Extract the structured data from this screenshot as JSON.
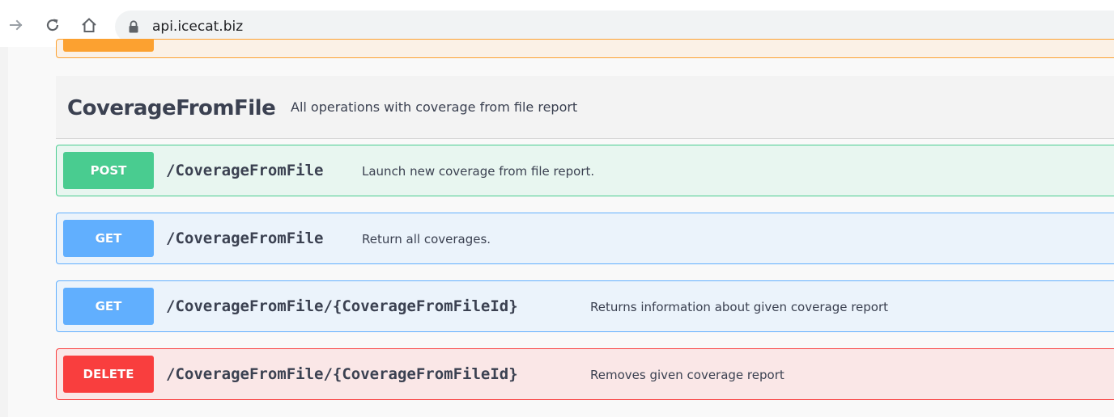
{
  "browser": {
    "url": "api.icecat.biz",
    "forward_icon": "arrow-right-icon",
    "reload_icon": "reload-icon",
    "home_icon": "home-icon",
    "lock_icon": "lock-icon"
  },
  "tag": {
    "title": "CoverageFromFile",
    "description": "All operations with coverage from file report"
  },
  "operations": [
    {
      "method": "POST",
      "path": "/CoverageFromFile",
      "summary": "Launch new coverage from file report.",
      "color": "#49cc90"
    },
    {
      "method": "GET",
      "path": "/CoverageFromFile",
      "summary": "Return all coverages.",
      "color": "#61affe"
    },
    {
      "method": "GET",
      "path": "/CoverageFromFile/{CoverageFromFileId}",
      "summary": "Returns information about given coverage report",
      "color": "#61affe"
    },
    {
      "method": "DELETE",
      "path": "/CoverageFromFile/{CoverageFromFileId}",
      "summary": "Removes given coverage report",
      "color": "#f93e3e"
    }
  ],
  "colors": {
    "put_accent": "#fca130",
    "text": "#3b4151"
  }
}
